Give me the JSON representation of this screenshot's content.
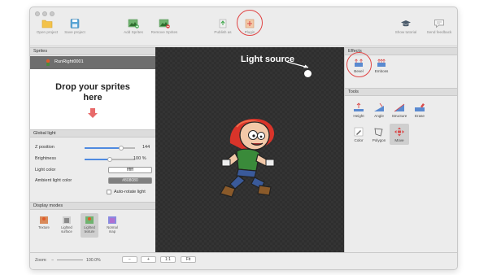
{
  "toolbar": {
    "open_project": "Open project",
    "save_project": "Save project",
    "add_sprites": "Add Sprites",
    "remove_sprites": "Remove Sprites",
    "publish": "Publish as",
    "plugin": "Plugin",
    "tutorial": "Show tutorial",
    "feedback": "Send feedback"
  },
  "sprites": {
    "header": "Sprites",
    "name": "RunRight0001",
    "drop_text_line1": "Drop your sprites",
    "drop_text_line2": "here"
  },
  "global_light": {
    "header": "Global light",
    "z_label": "Z position",
    "z_value": "144",
    "z_fraction": 0.72,
    "brightness_label": "Brightness",
    "brightness_value": "100 %",
    "brightness_fraction": 0.5,
    "light_color_label": "Light color",
    "light_color_value": "ffffff",
    "ambient_label": "Ambient light color",
    "ambient_value": "#808080",
    "auto_rotate_label": "Auto-rotate light"
  },
  "display_modes": {
    "header": "Display modes",
    "items": [
      "Texture",
      "Lighted surface",
      "Lighted texture",
      "Normal map"
    ],
    "selected_index": 2
  },
  "canvas": {
    "annotation": "Light source"
  },
  "effects": {
    "header": "Effects",
    "bevel": "Bevel",
    "emboss": "Emboss"
  },
  "tools": {
    "header": "Tools",
    "row1": [
      "Height",
      "Angle",
      "Structure",
      "Erase"
    ],
    "row2": [
      "Color",
      "Polygon",
      "Move"
    ],
    "selected": "Move"
  },
  "statusbar": {
    "zoom_label": "Zoom:",
    "zoom_minus": "−",
    "zoom_value": "100.0%",
    "btn_minus": "−",
    "btn_plus": "+",
    "btn_one": "1:1",
    "btn_fit": "Fit"
  },
  "colors": {
    "accent": "#4f8ae0",
    "highlight": "#e04444",
    "canvas_bg": "#2e2e2e"
  }
}
